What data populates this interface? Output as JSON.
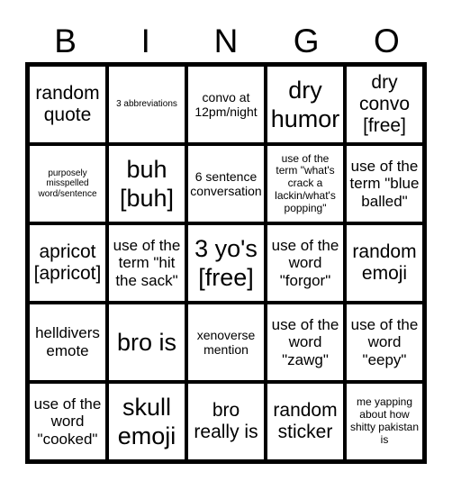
{
  "header": [
    "B",
    "I",
    "N",
    "G",
    "O"
  ],
  "cells": [
    [
      "random quote",
      "3 abbreviations",
      "convo at 12pm/night",
      "dry humor",
      "dry convo [free]"
    ],
    [
      "purposely misspelled word/sentence",
      "buh [buh]",
      "6 sentence conversation",
      "use of the term \"what's crack a lackin/what's popping\"",
      "use of the term \"blue balled\""
    ],
    [
      "apricot [apricot]",
      "use of the term \"hit the sack\"",
      "3 yo's [free]",
      "use of the word \"forgor\"",
      "random emoji"
    ],
    [
      "helldivers emote",
      "bro is",
      "xenoverse mention",
      "use of the word \"zawg\"",
      "use of the word \"eepy\""
    ],
    [
      "use of the word \"cooked\"",
      "skull emoji",
      "bro really is",
      "random sticker",
      "me yapping about how shitty pakistan is"
    ]
  ]
}
